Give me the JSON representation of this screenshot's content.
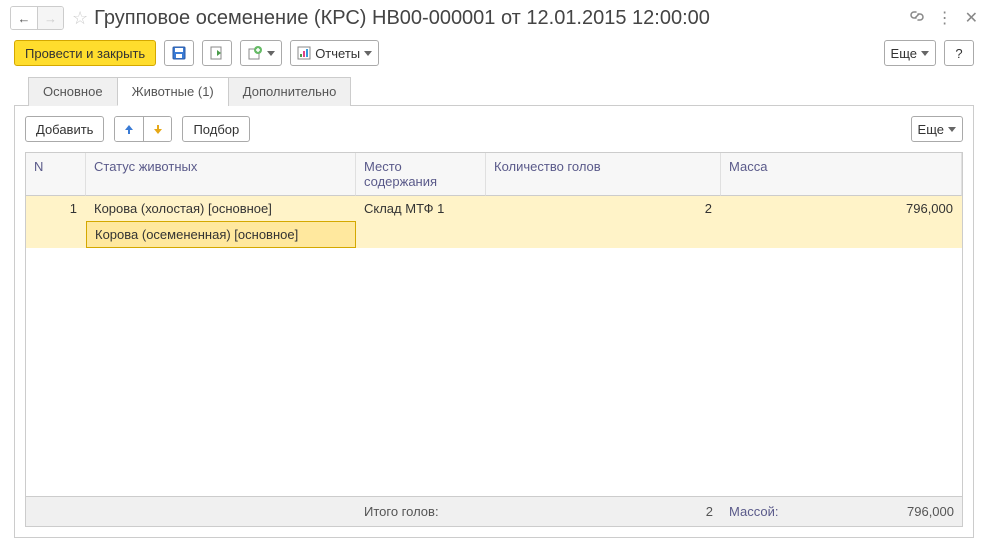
{
  "title": "Групповое осеменение (КРС) НВ00-000001 от 12.01.2015 12:00:00",
  "toolbar": {
    "primary": "Провести и закрыть",
    "reports": "Отчеты",
    "more": "Еще",
    "help": "?"
  },
  "tabs": [
    {
      "label": "Основное",
      "active": false
    },
    {
      "label": "Животные (1)",
      "active": true
    },
    {
      "label": "Дополнительно",
      "active": false
    }
  ],
  "inner": {
    "add": "Добавить",
    "pick": "Подбор",
    "more": "Еще"
  },
  "columns": {
    "n": "N",
    "status": "Статус животных",
    "location": "Место содержания",
    "count": "Количество голов",
    "mass": "Масса"
  },
  "rows": [
    {
      "n": "1",
      "status": "Корова (холостая) [основное]",
      "substatus": "Корова (осемененная) [основное]",
      "location": "Склад МТФ 1",
      "count": "2",
      "mass": "796,000"
    }
  ],
  "footer": {
    "count_label": "Итого голов:",
    "count_value": "2",
    "mass_label": "Массой:",
    "mass_value": "796,000"
  }
}
